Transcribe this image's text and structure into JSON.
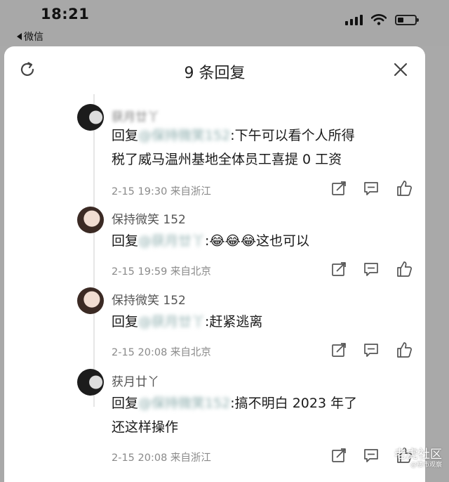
{
  "status_bar": {
    "time": "18:21",
    "back_app": "微信"
  },
  "header": {
    "title": "9 条回复"
  },
  "replies": [
    {
      "author": "获月廿丫",
      "reply_prefix": "回复",
      "mention": "@保持微笑152",
      "text_line1": ":下午可以看个人所得",
      "text_line2": "税了威马温州基地全体员工喜提 0 工资",
      "meta": "2-15 19:30  来自浙江"
    },
    {
      "author": "保持微笑 152",
      "reply_prefix": "回复",
      "mention": "@获月廿丫",
      "text_line1": ":😂😂😂这也可以",
      "meta": "2-15 19:59  来自北京"
    },
    {
      "author": "保持微笑 152",
      "reply_prefix": "回复",
      "mention": "@获月廿丫",
      "text_line1": ":赶紧逃离",
      "meta": "2-15 20:08  来自北京"
    },
    {
      "author": "获月廿丫",
      "reply_prefix": "回复",
      "mention": "@保持微笑152",
      "text_line1": ":搞不明白 2023 年了",
      "text_line2": "还这样操作",
      "meta": "2-15 20:08  来自浙江"
    }
  ],
  "watermark": {
    "main": "老虎社区",
    "sub": "@楼市观察"
  }
}
